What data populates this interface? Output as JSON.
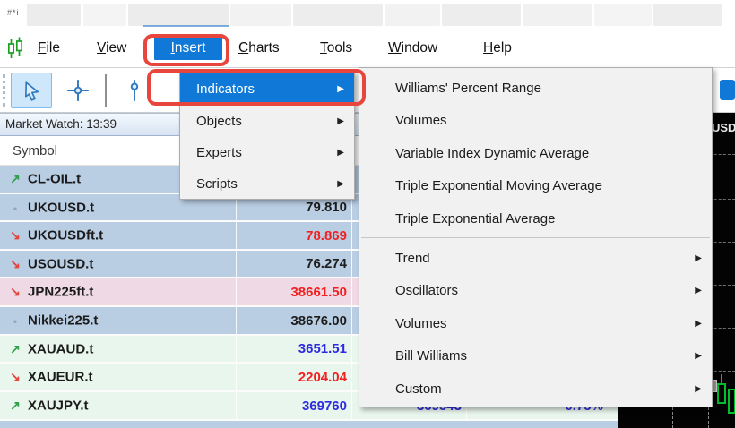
{
  "titlebar": {
    "blur_fragment": "#*i"
  },
  "menubar": {
    "items": [
      {
        "label": "File",
        "active": false
      },
      {
        "label": "View",
        "active": false
      },
      {
        "label": "Insert",
        "active": true
      },
      {
        "label": "Charts",
        "active": false
      },
      {
        "label": "Tools",
        "active": false
      },
      {
        "label": "Window",
        "active": false
      },
      {
        "label": "Help",
        "active": false
      }
    ]
  },
  "toolbar": {
    "tools": [
      {
        "name": "cursor-tool",
        "selected": true
      },
      {
        "name": "crosshair-tool",
        "selected": false
      },
      {
        "name": "vertical-line-tool",
        "selected": false
      }
    ]
  },
  "insert_menu": {
    "items": [
      {
        "label": "Indicators",
        "highlighted": true,
        "has_submenu": true
      },
      {
        "label": "Objects",
        "highlighted": false,
        "has_submenu": true
      },
      {
        "label": "Experts",
        "highlighted": false,
        "has_submenu": true
      },
      {
        "label": "Scripts",
        "highlighted": false,
        "has_submenu": true
      }
    ]
  },
  "indicators_submenu": {
    "plain_items": [
      {
        "label": "Williams' Percent Range"
      },
      {
        "label": "Volumes"
      },
      {
        "label": "Variable Index Dynamic Average"
      },
      {
        "label": "Triple Exponential Moving Average"
      },
      {
        "label": "Triple Exponential Average"
      }
    ],
    "group_items": [
      {
        "label": "Trend"
      },
      {
        "label": "Oscillators"
      },
      {
        "label": "Volumes"
      },
      {
        "label": "Bill Williams"
      },
      {
        "label": "Custom"
      }
    ]
  },
  "market_watch": {
    "title": "Market Watch: 13:39",
    "symbol_column_header": "Symbol",
    "rows": [
      {
        "symbol": "CL-OIL.t",
        "trend": "up",
        "tone": "blue",
        "bid": "",
        "bid_color": "black",
        "ask": "",
        "ask_color": "blue",
        "change": "",
        "change_color": "blue"
      },
      {
        "symbol": "UKOUSD.t",
        "trend": "flat",
        "tone": "blue",
        "bid": "79.810",
        "bid_color": "black",
        "ask": "",
        "ask_color": "blue",
        "change": "",
        "change_color": "blue"
      },
      {
        "symbol": "UKOUSDft.t",
        "trend": "down",
        "tone": "blue",
        "bid": "78.869",
        "bid_color": "red",
        "ask": "",
        "ask_color": "blue",
        "change": "",
        "change_color": "blue"
      },
      {
        "symbol": "USOUSD.t",
        "trend": "down",
        "tone": "blue",
        "bid": "76.274",
        "bid_color": "black",
        "ask": "",
        "ask_color": "blue",
        "change": "",
        "change_color": "blue"
      },
      {
        "symbol": "JPN225ft.t",
        "trend": "down",
        "tone": "pink",
        "bid": "38661.50",
        "bid_color": "red",
        "ask": "",
        "ask_color": "blue",
        "change": "",
        "change_color": "blue"
      },
      {
        "symbol": "Nikkei225.t",
        "trend": "flat",
        "tone": "blue",
        "bid": "38676.00",
        "bid_color": "black",
        "ask": "",
        "ask_color": "blue",
        "change": "",
        "change_color": "blue"
      },
      {
        "symbol": "XAUAUD.t",
        "trend": "up",
        "tone": "green",
        "bid": "3651.51",
        "bid_color": "blue",
        "ask": "",
        "ask_color": "blue",
        "change": "",
        "change_color": "blue"
      },
      {
        "symbol": "XAUEUR.t",
        "trend": "down",
        "tone": "green",
        "bid": "2204.04",
        "bid_color": "red",
        "ask": "",
        "ask_color": "blue",
        "change": "",
        "change_color": "blue"
      },
      {
        "symbol": "XAUJPY.t",
        "trend": "up",
        "tone": "green",
        "bid": "369760",
        "bid_color": "blue",
        "ask": "369543",
        "ask_color": "blue",
        "change": "0.75%",
        "change_color": "blue"
      },
      {
        "symbol": "",
        "trend": "none",
        "tone": "blue",
        "bid": "",
        "bid_color": "black",
        "ask": "",
        "ask_color": "blue",
        "change": "",
        "change_color": "blue"
      }
    ]
  },
  "chart": {
    "symbol_fragment": "USD"
  },
  "colors": {
    "accent_blue": "#1079d8",
    "annotation_red": "#e8463d",
    "trend_up_green": "#2fa14b",
    "trend_down_red": "#e2453c",
    "bid_red": "#f2201e",
    "bid_blue": "#2d2bdf",
    "candle_green": "#00bf2a",
    "row_blue": "#b9cde3",
    "row_pink": "#eed9e4",
    "row_green": "#e9f6ed"
  }
}
